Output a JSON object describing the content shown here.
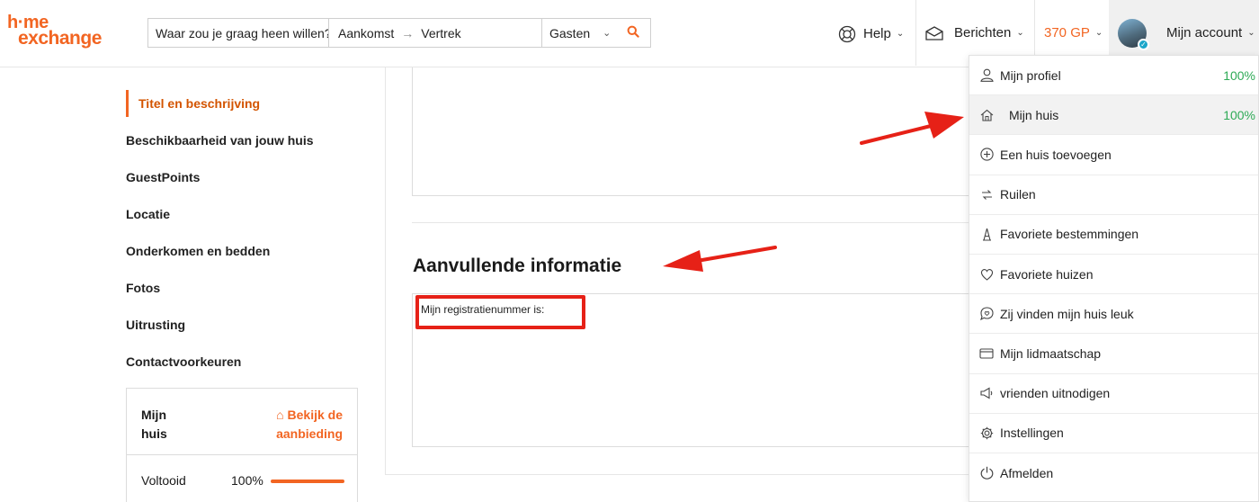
{
  "header": {
    "logo_line1": "h·me",
    "logo_line2": "exchange",
    "search": {
      "destination": "Waar zou je graag heen willen?",
      "arrival": "Aankomst",
      "departure": "Vertrek",
      "guests": "Gasten"
    },
    "help_label": "Help",
    "messages_label": "Berichten",
    "guestpoints": "370 GP",
    "account_label": "Mijn account"
  },
  "sidebar": {
    "items": [
      "Titel en beschrijving",
      "Beschikbaarheid van jouw huis",
      "GuestPoints",
      "Locatie",
      "Onderkomen en bedden",
      "Fotos",
      "Uitrusting",
      "Contactvoorkeuren"
    ],
    "card": {
      "title": "Mijn huis",
      "link_label": "Bekijk de aanbieding",
      "status_label": "Voltooid",
      "status_pct": "100%",
      "progress": 1.0
    }
  },
  "main": {
    "section_title": "Aanvullende informatie",
    "additional_text": "Mijn registratienummer is:"
  },
  "account_menu": {
    "items": [
      {
        "icon": "user-icon",
        "label": "Mijn profiel",
        "pct": "100%"
      },
      {
        "icon": "home-icon",
        "label": "Mijn huis",
        "pct": "100%"
      },
      {
        "icon": "plus-circle-icon",
        "label": "Een huis toevoegen",
        "pct": ""
      },
      {
        "icon": "swap-icon",
        "label": "Ruilen",
        "pct": ""
      },
      {
        "icon": "landmark-icon",
        "label": "Favoriete bestemmingen",
        "pct": ""
      },
      {
        "icon": "heart-icon",
        "label": "Favoriete huizen",
        "pct": ""
      },
      {
        "icon": "speech-heart-icon",
        "label": "Zij vinden mijn huis leuk",
        "pct": ""
      },
      {
        "icon": "card-icon",
        "label": "Mijn lidmaatschap",
        "pct": ""
      },
      {
        "icon": "megaphone-icon",
        "label": "vrienden uitnodigen",
        "pct": ""
      },
      {
        "icon": "gear-icon",
        "label": "Instellingen",
        "pct": ""
      },
      {
        "icon": "power-icon",
        "label": "Afmelden",
        "pct": ""
      }
    ]
  },
  "colors": {
    "brand": "#f26522",
    "success": "#2eaa56",
    "annotation": "#e62117"
  }
}
